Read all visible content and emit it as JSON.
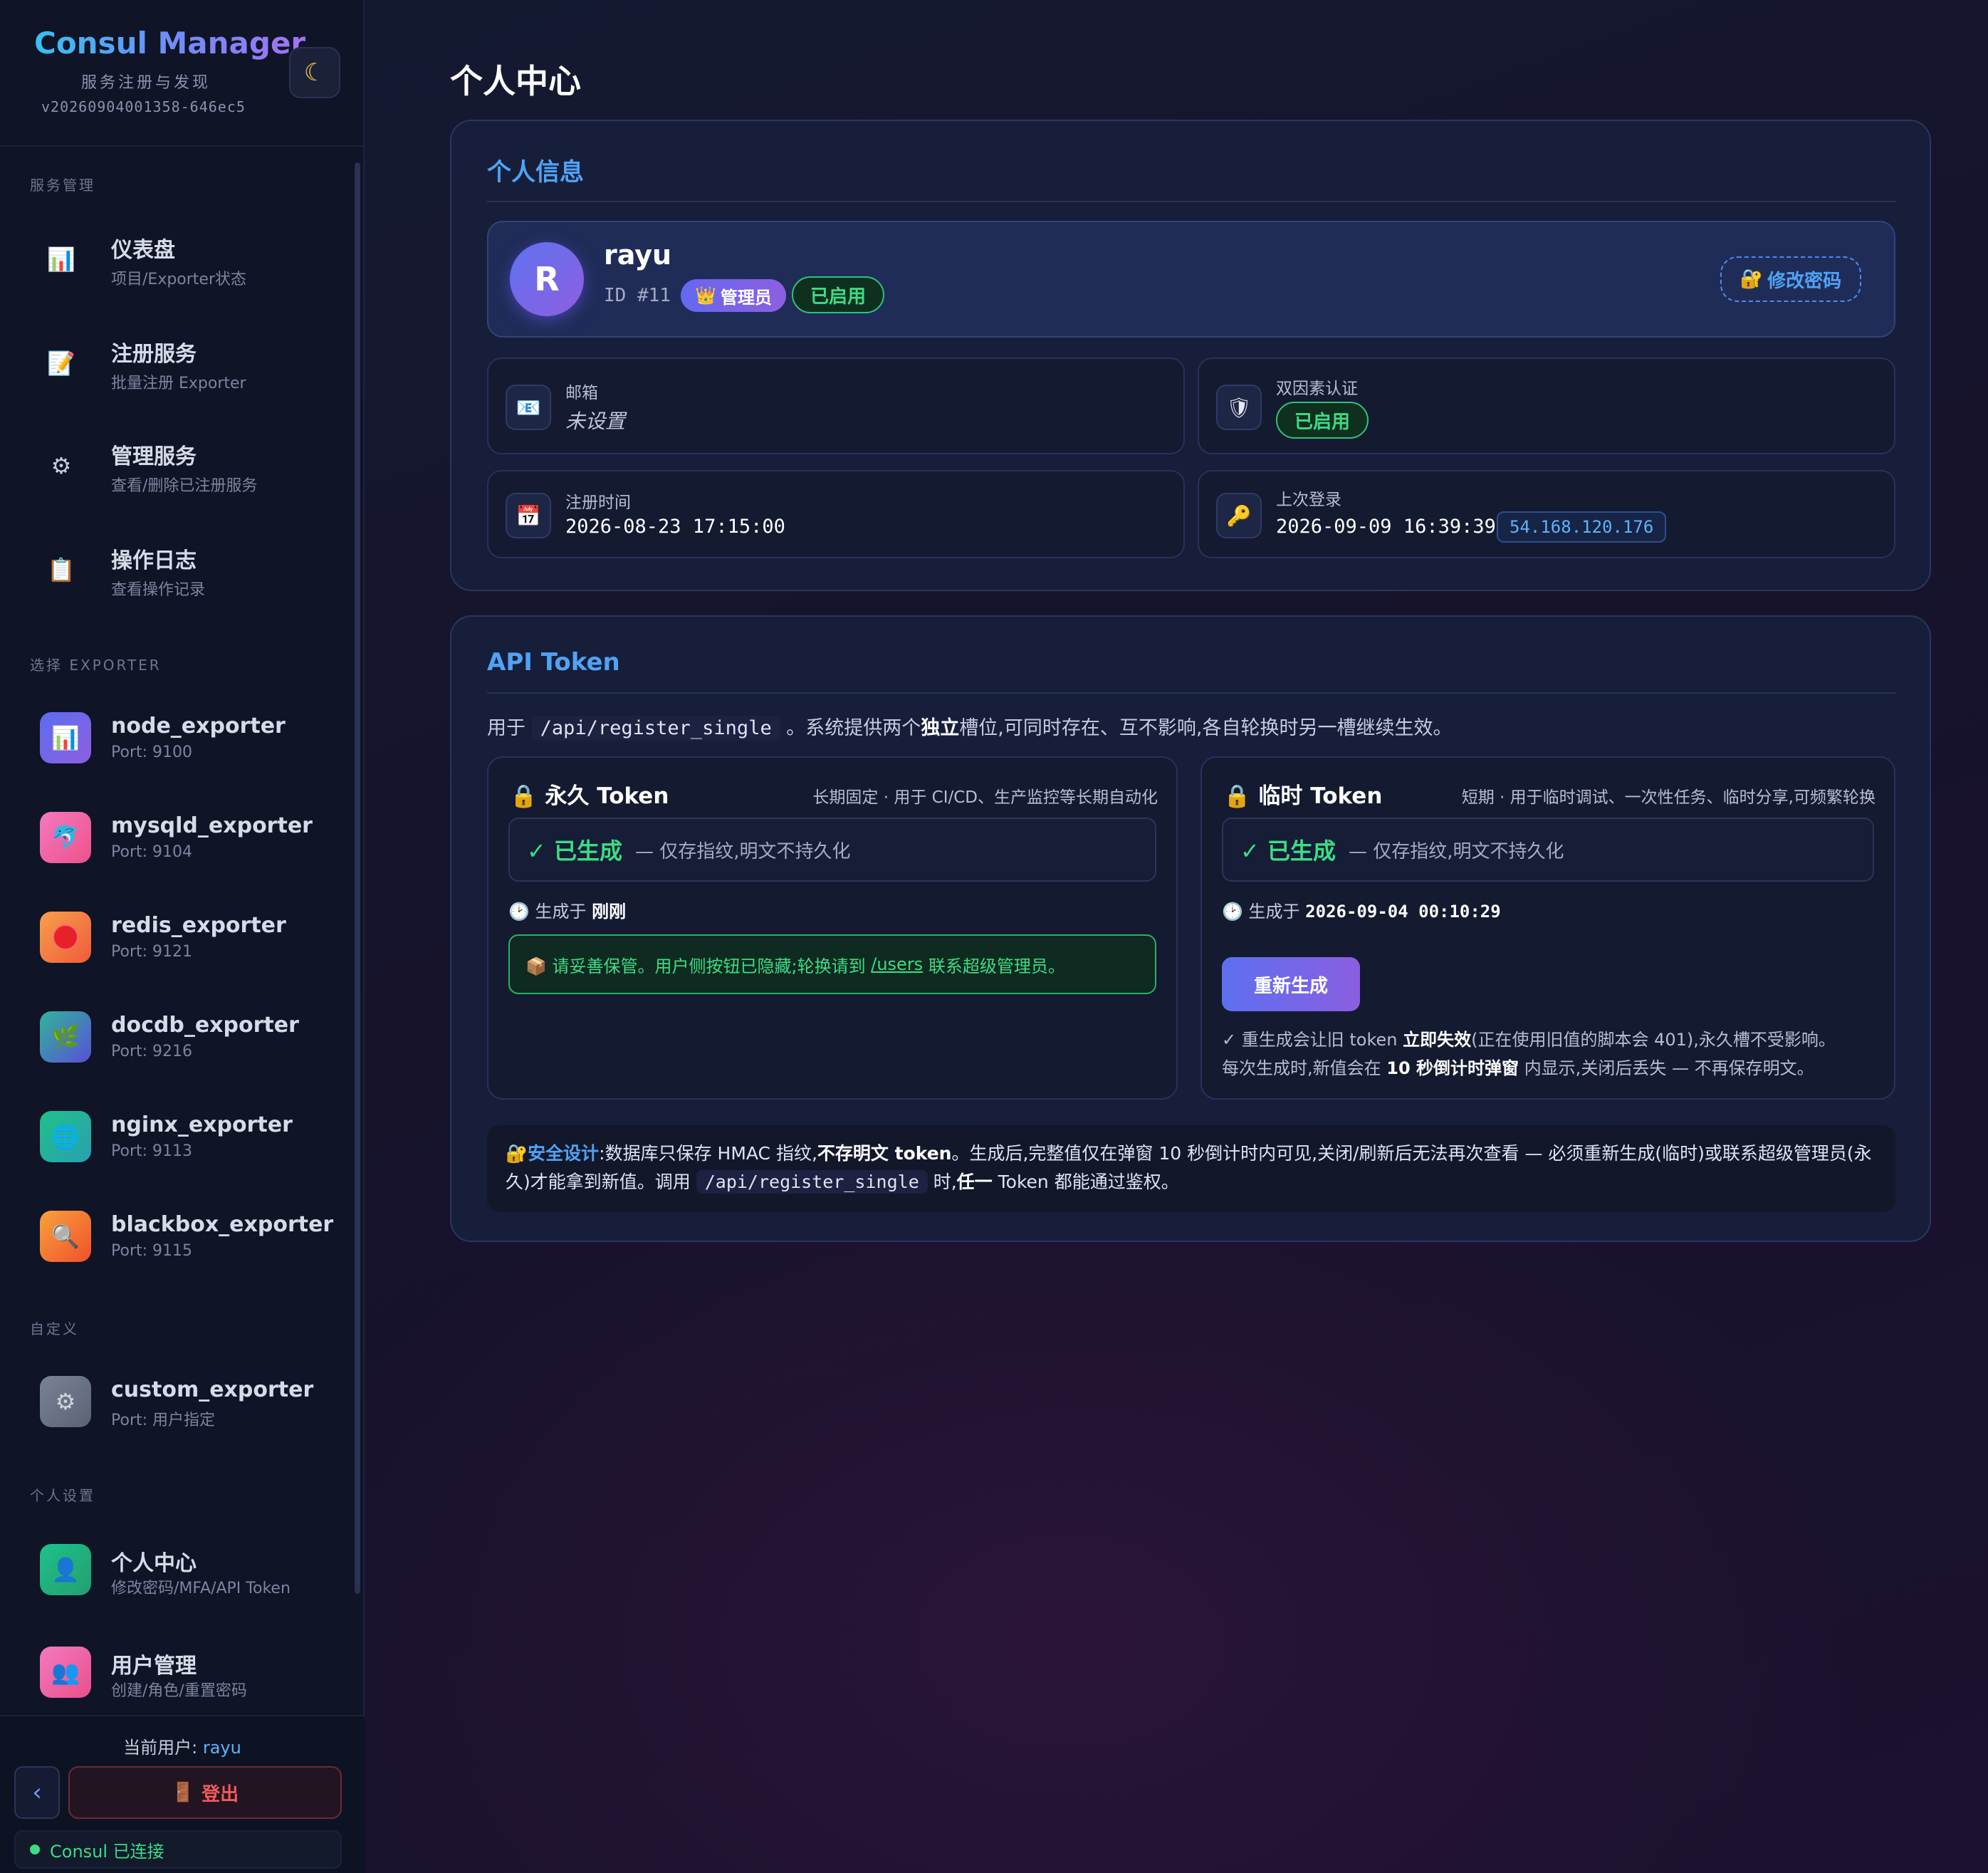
{
  "sidebar": {
    "brand_title": "Consul Manager",
    "brand_sub": "服务注册与发现",
    "version": "v20260904001358-646ec5",
    "theme_icon": "moon-icon",
    "sections": {
      "service": "服务管理",
      "exporter": "选择 EXPORTER",
      "custom": "自定义",
      "personal": "个人设置"
    },
    "nav": [
      {
        "label": "仪表盘",
        "sub": "项目/Exporter状态",
        "icon": "bar-chart-icon"
      },
      {
        "label": "注册服务",
        "sub": "批量注册 Exporter",
        "icon": "memo-icon"
      },
      {
        "label": "管理服务",
        "sub": "查看/删除已注册服务",
        "icon": "gear-icon"
      },
      {
        "label": "操作日志",
        "sub": "查看操作记录",
        "icon": "clipboard-icon"
      }
    ],
    "exporters": [
      {
        "label": "node_exporter",
        "sub": "Port: 9100",
        "icon": "bar-chart-icon",
        "color": "#5b6df0"
      },
      {
        "label": "mysqld_exporter",
        "sub": "Port: 9104",
        "icon": "dolphin-icon",
        "color": "#f05fa0"
      },
      {
        "label": "redis_exporter",
        "sub": "Port: 9121",
        "icon": "red-circle-icon",
        "color": "#f57b3c"
      },
      {
        "label": "docdb_exporter",
        "sub": "Port: 9216",
        "icon": "leaf-icon",
        "color": "#3aa3b8"
      },
      {
        "label": "nginx_exporter",
        "sub": "Port: 9113",
        "icon": "globe-icon",
        "color": "#22b07a"
      },
      {
        "label": "blackbox_exporter",
        "sub": "Port: 9115",
        "icon": "magnifier-icon",
        "color": "#f5792e"
      }
    ],
    "custom": {
      "label": "custom_exporter",
      "sub": "Port: 用户指定",
      "icon": "gear-icon",
      "color": "#6a7386"
    },
    "personal": [
      {
        "label": "个人中心",
        "sub": "修改密码/MFA/API Token",
        "icon": "user-icon",
        "color": "#22b07a"
      },
      {
        "label": "用户管理",
        "sub": "创建/角色/重置密码",
        "icon": "users-icon",
        "color": "#f05fa0"
      }
    ],
    "current_user_label": "当前用户:",
    "current_user": "rayu",
    "collapse_label": "‹",
    "logout_label": "登出",
    "status": "Consul 已连接"
  },
  "page": {
    "title": "个人中心"
  },
  "profile": {
    "section_title": "个人信息",
    "avatar_letter": "R",
    "username": "rayu",
    "user_id": "ID #11",
    "role_badge": "管理员",
    "status_badge": "已启用",
    "change_password": "修改密码",
    "email_label": "邮箱",
    "email_value": "未设置",
    "mfa_label": "双因素认证",
    "mfa_value": "已启用",
    "registered_label": "注册时间",
    "registered_value": "2026-08-23 17:15:00",
    "last_login_label": "上次登录",
    "last_login_value": "2026-09-09 16:39:39",
    "last_login_ip": "54.168.120.176"
  },
  "api_token": {
    "section_title": "API Token",
    "desc_prefix": "用于",
    "desc_code": "/api/register_single",
    "desc_mid": "。系统提供两个",
    "desc_bold": "独立",
    "desc_suffix": "槽位,可同时存在、互不影响,各自轮换时另一槽继续生效。",
    "permanent": {
      "title": "永久 Token",
      "note": "长期固定 · 用于 CI/CD、生产监控等长期自动化",
      "status": "✓ 已生成",
      "status_desc": "— 仅存指纹,明文不持久化",
      "generated_prefix": "生成于",
      "generated_value": "刚刚",
      "warning_prefix": "📦 请妥善保管。用户侧按钮已隐藏;轮换请到",
      "warning_link": "/users",
      "warning_suffix": "联系超级管理员。"
    },
    "temporary": {
      "title": "临时 Token",
      "note": "短期 · 用于临时调试、一次性任务、临时分享,可频繁轮换",
      "status": "✓ 已生成",
      "status_desc": "— 仅存指纹,明文不持久化",
      "generated_prefix": "生成于",
      "generated_value": "2026-09-04 00:10:29",
      "regenerate": "重新生成",
      "note1_a": "✓ 重生成会让旧 token",
      "note1_b": "立即失效",
      "note1_c": "(正在使用旧值的脚本会 401),永久槽不受影响。",
      "note2_a": "每次生成时,新值会在",
      "note2_b": "10 秒倒计时弹窗",
      "note2_c": "内显示,关闭后丢失 — 不再保存明文。"
    },
    "security": {
      "heading": "安全设计",
      "t1": ":数据库只保存 HMAC 指纹,",
      "t2": "不存明文 token",
      "t3": "。生成后,完整值仅在弹窗 10 秒倒计时内可见,关闭/刷新后无法再次查看 — 必须重新生成(临时)或联系超级管理员(永久)才能拿到新值。调用",
      "code": "/api/register_single",
      "t4": "时,",
      "t5": "任一",
      "t6": "Token 都能通过鉴权。"
    }
  }
}
